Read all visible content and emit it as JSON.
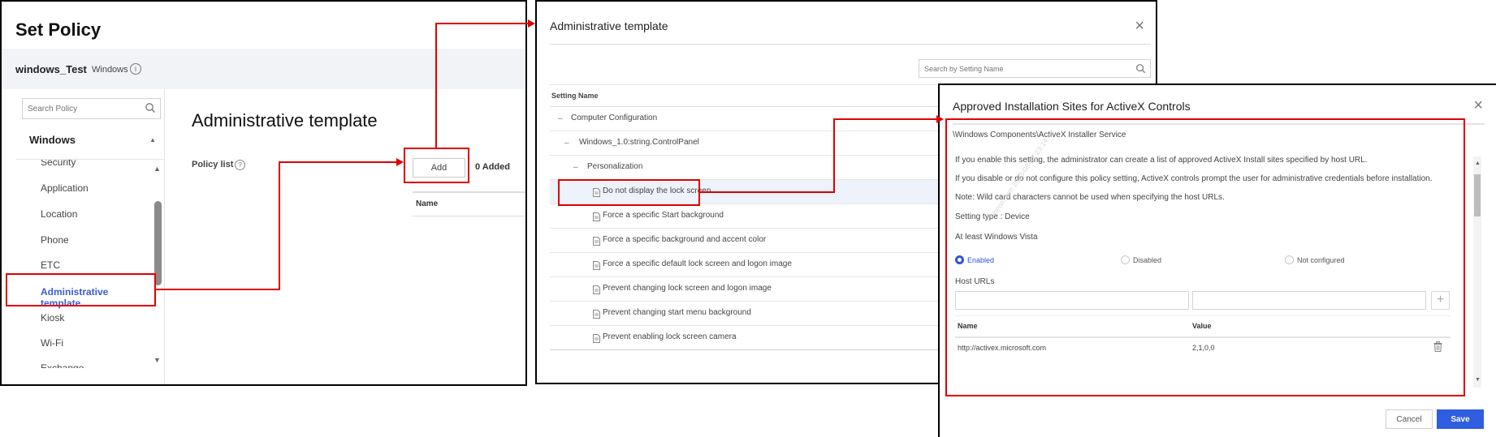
{
  "set_policy": {
    "title": "Set Policy",
    "device_name": "windows_Test",
    "device_os": "Windows",
    "info_icon": "info-icon",
    "sidebar": {
      "search_placeholder": "Search Policy",
      "group": "Windows",
      "items": [
        {
          "label": "Security",
          "active": false
        },
        {
          "label": "Application",
          "active": false
        },
        {
          "label": "Location",
          "active": false
        },
        {
          "label": "Phone",
          "active": false
        },
        {
          "label": "ETC",
          "active": false
        },
        {
          "label": "Administrative template",
          "active": true
        },
        {
          "label": "Kiosk",
          "active": false
        },
        {
          "label": "Wi-Fi",
          "active": false
        },
        {
          "label": "Exchange",
          "active": false
        }
      ]
    },
    "main": {
      "title": "Administrative template",
      "policy_list_label": "Policy list",
      "add_button": "Add",
      "added_count": "0 Added",
      "table_header_name": "Name"
    }
  },
  "admin_template_dialog": {
    "title": "Administrative template",
    "close_icon": "×",
    "search_placeholder": "Search by Setting Name",
    "column_header": "Setting Name",
    "tree": [
      {
        "label": "Computer Configuration",
        "type": "folder",
        "level": 0
      },
      {
        "label": "Windows_1.0:string.ControlPanel",
        "type": "folder",
        "level": 1
      },
      {
        "label": "Personalization",
        "type": "folder",
        "level": 2
      },
      {
        "label": "Do not display the lock screen",
        "type": "setting",
        "level": 3,
        "selected": true
      },
      {
        "label": "Force a specific Start background",
        "type": "setting",
        "level": 3
      },
      {
        "label": "Force a specific background and accent color",
        "type": "setting",
        "level": 3
      },
      {
        "label": "Force a specific default lock screen and logon image",
        "type": "setting",
        "level": 3
      },
      {
        "label": "Prevent changing lock screen and logon image",
        "type": "setting",
        "level": 3
      },
      {
        "label": "Prevent changing start menu background",
        "type": "setting",
        "level": 3
      },
      {
        "label": "Prevent enabling lock screen camera",
        "type": "setting",
        "level": 3
      }
    ]
  },
  "setting_dialog": {
    "title": "Approved Installation Sites for ActiveX Controls",
    "close_icon": "×",
    "path": "\\Windows Components\\ActiveX Installer Service",
    "descriptions": [
      "If you enable this setting, the administrator can create a list of approved ActiveX Install sites specified by host URL.",
      "If you disable or do not configure this policy setting, ActiveX controls prompt the user for administrative credentials before installation.",
      "Note: Wild card characters cannot be used when specifying the host URLs."
    ],
    "setting_type": "Setting type : Device",
    "supported_on": "At least Windows Vista",
    "options": [
      {
        "label": "Enabled",
        "selected": true
      },
      {
        "label": "Disabled",
        "selected": false
      },
      {
        "label": "Not configured",
        "selected": false
      }
    ],
    "host_urls_label": "Host URLs",
    "host_name_input": "",
    "host_value_input": "",
    "add_icon": "+",
    "table": {
      "headers": [
        "Name",
        "Value"
      ],
      "rows": [
        {
          "name": "http://activex.microsoft.com",
          "value": "2,1,0,0"
        }
      ]
    },
    "watermark": "hbeom.kim 2023-08-07 23:14:4",
    "cancel_button": "Cancel",
    "save_button": "Save"
  },
  "colors": {
    "accent": "#2f5ee0",
    "active_nav": "#3b5bdb",
    "annotation": "#e00000",
    "selected_row": "#eef3fb"
  }
}
